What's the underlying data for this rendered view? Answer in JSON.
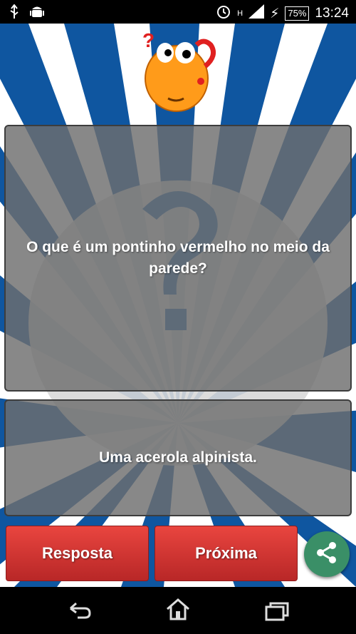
{
  "status_bar": {
    "time": "13:24",
    "battery": "75%",
    "network": "H"
  },
  "question": {
    "text": "O que é um pontinho vermelho no meio da parede?"
  },
  "answer": {
    "text": "Uma acerola alpinista."
  },
  "buttons": {
    "answer_label": "Resposta",
    "next_label": "Próxima"
  },
  "icons": {
    "share": "share-icon",
    "back": "back-icon",
    "home": "home-icon",
    "recents": "recents-icon"
  },
  "colors": {
    "button_red": "#d93a35",
    "share_green": "#3a8f67",
    "rays_blue": "#1a5fa8"
  }
}
